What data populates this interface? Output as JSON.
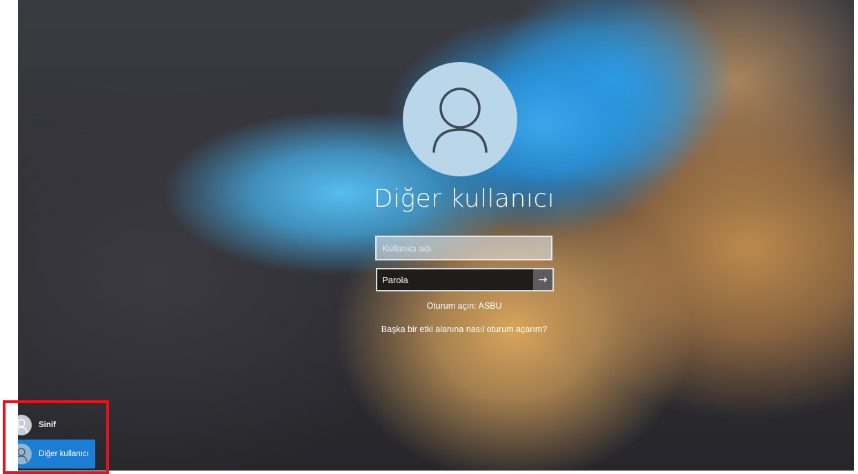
{
  "login": {
    "display_name": "Diğer kullanıcı",
    "username_placeholder": "Kullanıcı adı",
    "password_placeholder": "Parola",
    "submit_glyph": "→",
    "signin_domain_text": "Oturum açın: ASBU",
    "help_link_text": "Başka bir etki alanına nasıl oturum açarım?"
  },
  "user_switcher": {
    "users": [
      {
        "name": "Sinif",
        "selected": false
      },
      {
        "name": "Diğer kullanıcı",
        "selected": true
      }
    ]
  },
  "icons": {
    "large_avatar": "user-icon",
    "submit": "arrow-right-icon",
    "mini_avatar": "user-icon"
  },
  "colors": {
    "selected_user": "#1c7fd3",
    "avatar_circle": "#b9d7e9",
    "annotation_box": "#e0161f"
  }
}
